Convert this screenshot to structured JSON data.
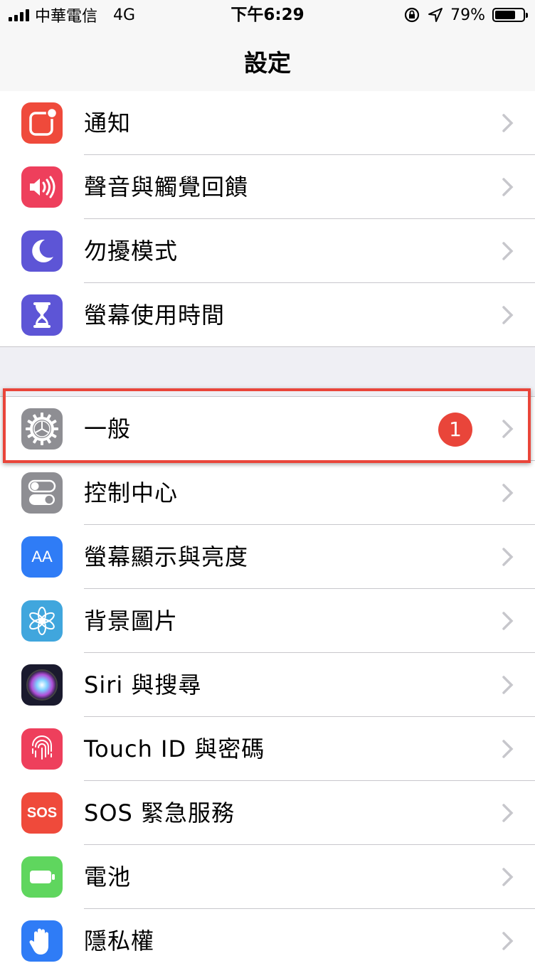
{
  "status_bar": {
    "carrier": "中華電信",
    "network": "4G",
    "time": "下午6:29",
    "battery": "79%",
    "battery_level": 0.79
  },
  "nav": {
    "title": "設定"
  },
  "group1": [
    {
      "label": "通知",
      "icon": "notifications-icon",
      "color": "#ef4a3b"
    },
    {
      "label": "聲音與觸覺回饋",
      "icon": "sound-icon",
      "color": "#ee3f5c"
    },
    {
      "label": "勿擾模式",
      "icon": "moon-icon",
      "color": "#5d55d6"
    },
    {
      "label": "螢幕使用時間",
      "icon": "hourglass-icon",
      "color": "#5d55d6"
    }
  ],
  "group2": [
    {
      "label": "一般",
      "icon": "gear-icon",
      "color": "#8e8e93",
      "badge": "1"
    },
    {
      "label": "控制中心",
      "icon": "toggle-icon",
      "color": "#8e8e93"
    },
    {
      "label": "螢幕顯示與亮度",
      "icon": "text-size-icon",
      "color": "#2f7cf6"
    },
    {
      "label": "背景圖片",
      "icon": "flower-icon",
      "color": "#40a6dd"
    },
    {
      "label": "Siri 與搜尋",
      "icon": "siri-icon",
      "color": "#1a1a2e"
    },
    {
      "label": "Touch ID 與密碼",
      "icon": "fingerprint-icon",
      "color": "#ee3f5c"
    },
    {
      "label": "SOS 緊急服務",
      "icon": "sos-icon",
      "color": "#ef4a3b",
      "icon_text": "SOS"
    },
    {
      "label": "電池",
      "icon": "battery-icon",
      "color": "#5fd65e"
    },
    {
      "label": "隱私權",
      "icon": "hand-icon",
      "color": "#2f7cf6"
    }
  ],
  "text_size_icon_text": "AA"
}
